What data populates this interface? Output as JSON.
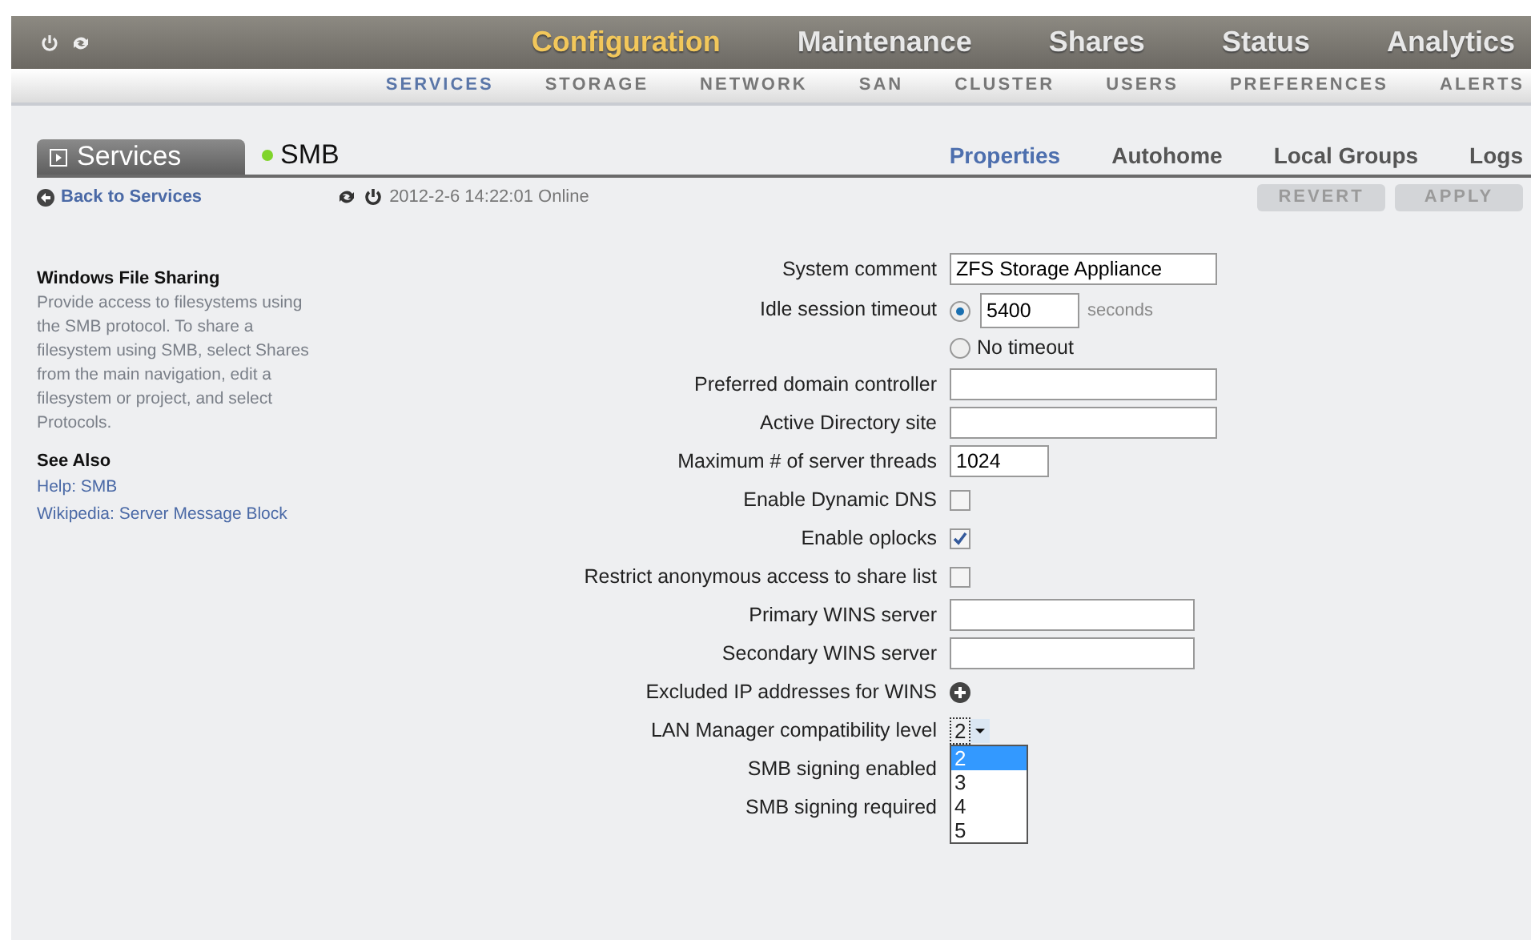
{
  "header": {
    "main_tabs": [
      {
        "label": "Configuration",
        "selected": true
      },
      {
        "label": "Maintenance",
        "selected": false
      },
      {
        "label": "Shares",
        "selected": false
      },
      {
        "label": "Status",
        "selected": false
      },
      {
        "label": "Analytics",
        "selected": false
      }
    ],
    "sub_tabs": [
      {
        "label": "SERVICES",
        "selected": true
      },
      {
        "label": "STORAGE",
        "selected": false
      },
      {
        "label": "NETWORK",
        "selected": false
      },
      {
        "label": "SAN",
        "selected": false
      },
      {
        "label": "CLUSTER",
        "selected": false
      },
      {
        "label": "USERS",
        "selected": false
      },
      {
        "label": "PREFERENCES",
        "selected": false
      },
      {
        "label": "ALERTS",
        "selected": false
      }
    ]
  },
  "breadcrumb": {
    "parent": "Services",
    "service": "SMB",
    "online": true
  },
  "page_tabs": [
    {
      "label": "Properties",
      "selected": true
    },
    {
      "label": "Autohome",
      "selected": false
    },
    {
      "label": "Local Groups",
      "selected": false
    },
    {
      "label": "Logs",
      "selected": false
    }
  ],
  "toolbar": {
    "back_link": "Back to Services",
    "status": "2012-2-6 14:22:01 Online",
    "buttons": [
      {
        "label": "REVERT",
        "disabled": true
      },
      {
        "label": "APPLY",
        "disabled": true
      }
    ]
  },
  "help": {
    "title": "Windows File Sharing",
    "text": "Provide access to filesystems using the SMB protocol. To share a filesystem using SMB, select Shares from the main navigation, edit a filesystem or project, and select Protocols.",
    "see_also_title": "See Also",
    "links": [
      "Help: SMB",
      "Wikipedia: Server Message Block"
    ]
  },
  "fields": [
    {
      "kind": "text",
      "label": "System comment",
      "value": "ZFS Storage Appliance"
    },
    {
      "kind": "timeout",
      "label": "Idle session timeout",
      "options": [
        {
          "value": "5400",
          "unit": "seconds",
          "selected": true
        },
        {
          "label": "No timeout",
          "selected": false
        }
      ]
    },
    {
      "kind": "text",
      "label": "Preferred domain controller"
    },
    {
      "kind": "text",
      "label": "Active Directory site"
    },
    {
      "kind": "number",
      "label": "Maximum # of server threads",
      "value": "1024"
    },
    {
      "kind": "checkbox",
      "label": "Enable Dynamic DNS",
      "checked": false
    },
    {
      "kind": "checkbox",
      "label": "Enable oplocks",
      "checked": true
    },
    {
      "kind": "checkbox",
      "label": "Restrict anonymous access to share list",
      "checked": false
    },
    {
      "kind": "address",
      "label": "Primary WINS server"
    },
    {
      "kind": "address",
      "label": "Secondary WINS server"
    },
    {
      "kind": "add",
      "label": "Excluded IP addresses for WINS"
    },
    {
      "kind": "select",
      "label": "LAN Manager compatibility level",
      "value": "2",
      "open": true,
      "options": [
        {
          "label": "2",
          "selected": true
        },
        {
          "label": "3",
          "selected": false
        },
        {
          "label": "4",
          "selected": false
        },
        {
          "label": "5",
          "selected": false
        }
      ]
    },
    {
      "kind": "hidden",
      "label": "SMB signing enabled"
    },
    {
      "kind": "hidden",
      "label": "SMB signing required"
    }
  ]
}
